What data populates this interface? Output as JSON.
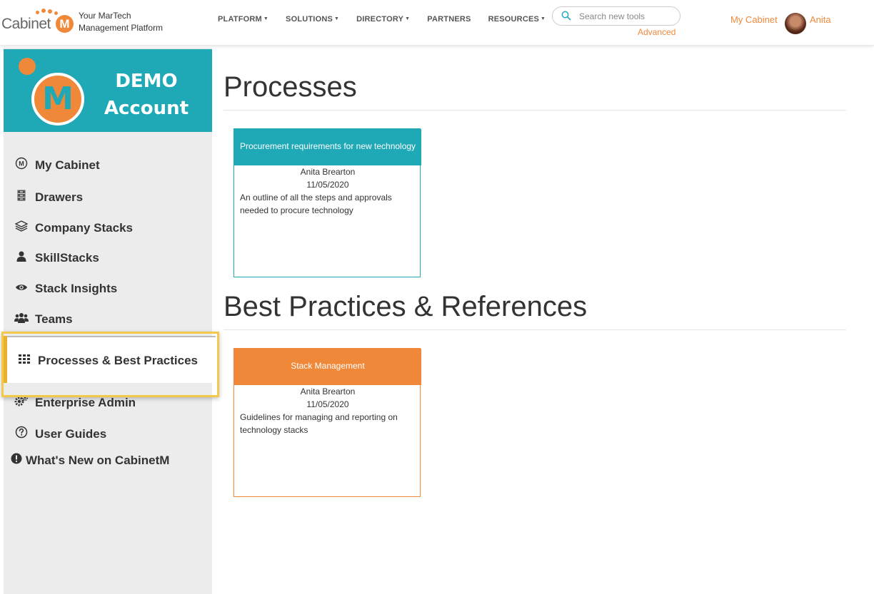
{
  "brand": {
    "logo_word": "Cabinet",
    "logo_mark": "M",
    "tagline_line1": "Your MarTech",
    "tagline_line2": "Management Platform"
  },
  "nav": {
    "items": [
      {
        "label": "PLATFORM",
        "has_caret": true
      },
      {
        "label": "SOLUTIONS",
        "has_caret": true
      },
      {
        "label": "DIRECTORY",
        "has_caret": true
      },
      {
        "label": "PARTNERS",
        "has_caret": false
      },
      {
        "label": "RESOURCES",
        "has_caret": true
      }
    ],
    "caret_glyph": "▼"
  },
  "search": {
    "placeholder": "Search new tools",
    "advanced_label": "Advanced"
  },
  "user": {
    "my_cabinet_label": "My Cabinet",
    "name": "Anita"
  },
  "sidebar": {
    "demo_line1": "DEMO",
    "demo_line2": "Account",
    "demo_mark": "M",
    "items": [
      {
        "label": "My Cabinet",
        "icon": "cabinet-m-icon"
      },
      {
        "label": "Drawers",
        "icon": "drawers-icon"
      },
      {
        "label": "Company Stacks",
        "icon": "layers-icon"
      },
      {
        "label": "SkillStacks",
        "icon": "user-icon"
      },
      {
        "label": "Stack Insights",
        "icon": "eye-icon"
      },
      {
        "label": "Teams",
        "icon": "users-icon"
      },
      {
        "label": "Processes & Best Practices",
        "icon": "grid-icon",
        "active": true
      },
      {
        "label": "Enterprise Admin",
        "icon": "gears-icon"
      },
      {
        "label": "User Guides",
        "icon": "question-circle-icon"
      },
      {
        "label": "What's New on CabinetM",
        "icon": "exclamation-circle-icon"
      }
    ]
  },
  "main": {
    "sections": [
      {
        "title": "Processes",
        "cards": [
          {
            "title": "Procurement requirements for new technology",
            "author": "Anita Brearton",
            "date": "11/05/2020",
            "description": "An outline of all the steps and approvals needed to procure technology",
            "color": "#1fa8b5"
          }
        ]
      },
      {
        "title": "Best Practices & References",
        "cards": [
          {
            "title": "Stack Management",
            "author": "Anita Brearton",
            "date": "11/05/2020",
            "description": "Guidelines for managing and reporting on technology stacks",
            "color": "#f0883a"
          }
        ]
      }
    ]
  },
  "colors": {
    "accent_orange": "#f0883a",
    "accent_teal": "#1fa8b5",
    "highlight_yellow": "#f2c94c"
  }
}
